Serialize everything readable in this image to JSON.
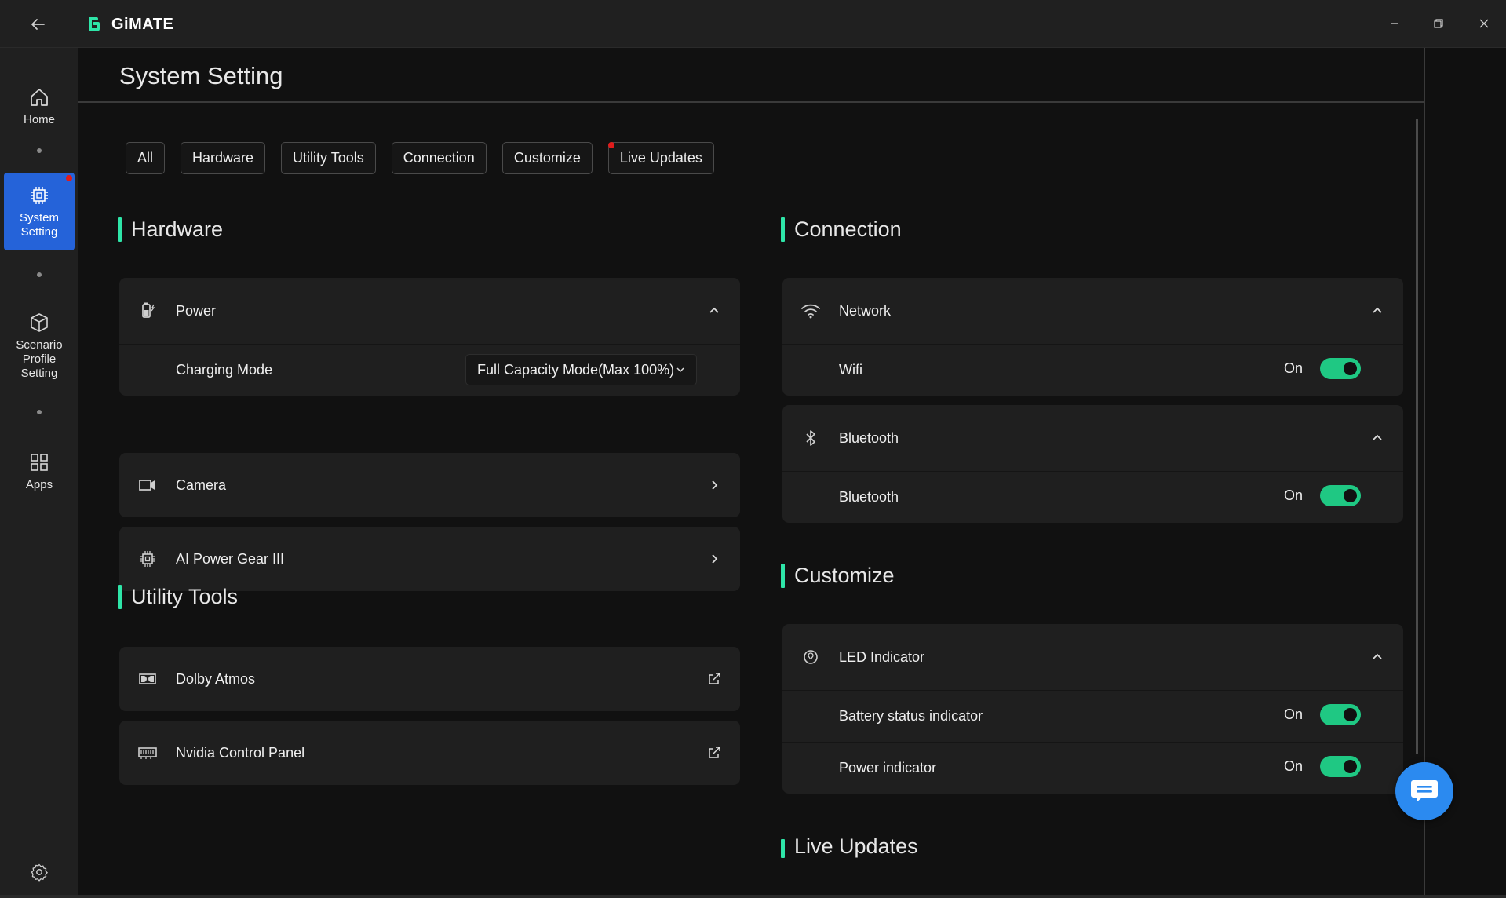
{
  "app": {
    "name": "GiMATE"
  },
  "sidebar": {
    "items": [
      {
        "label": "Home"
      },
      {
        "label": "System\nSetting"
      },
      {
        "label": "Scenario\nProfile\nSetting"
      },
      {
        "label": "Apps"
      }
    ]
  },
  "page": {
    "title": "System Setting"
  },
  "tabs": [
    "All",
    "Hardware",
    "Utility Tools",
    "Connection",
    "Customize",
    "Live Updates"
  ],
  "sections": {
    "hardware": {
      "title": "Hardware",
      "power": {
        "label": "Power",
        "charging_mode_label": "Charging Mode",
        "charging_mode_value": "Full Capacity Mode(Max 100%)"
      },
      "camera": {
        "label": "Camera"
      },
      "ai_power_gear": {
        "label": "AI Power Gear III"
      }
    },
    "utility": {
      "title": "Utility Tools",
      "dolby": {
        "label": "Dolby Atmos"
      },
      "nvidia": {
        "label": "Nvidia Control Panel"
      }
    },
    "connection": {
      "title": "Connection",
      "network": {
        "label": "Network",
        "wifi_label": "Wifi",
        "wifi_state": "On"
      },
      "bluetooth": {
        "label": "Bluetooth",
        "bt_label": "Bluetooth",
        "bt_state": "On"
      }
    },
    "customize": {
      "title": "Customize",
      "led": {
        "label": "LED Indicator",
        "battery_label": "Battery status indicator",
        "battery_state": "On",
        "power_label": "Power indicator",
        "power_state": "On"
      }
    },
    "live_updates": {
      "title": "Live Updates"
    }
  },
  "colors": {
    "accent": "#2ee5a8",
    "active_nav": "#2563d9",
    "toggle_on": "#1fc883",
    "notification": "#e01b1b",
    "chat": "#2b8af0"
  }
}
